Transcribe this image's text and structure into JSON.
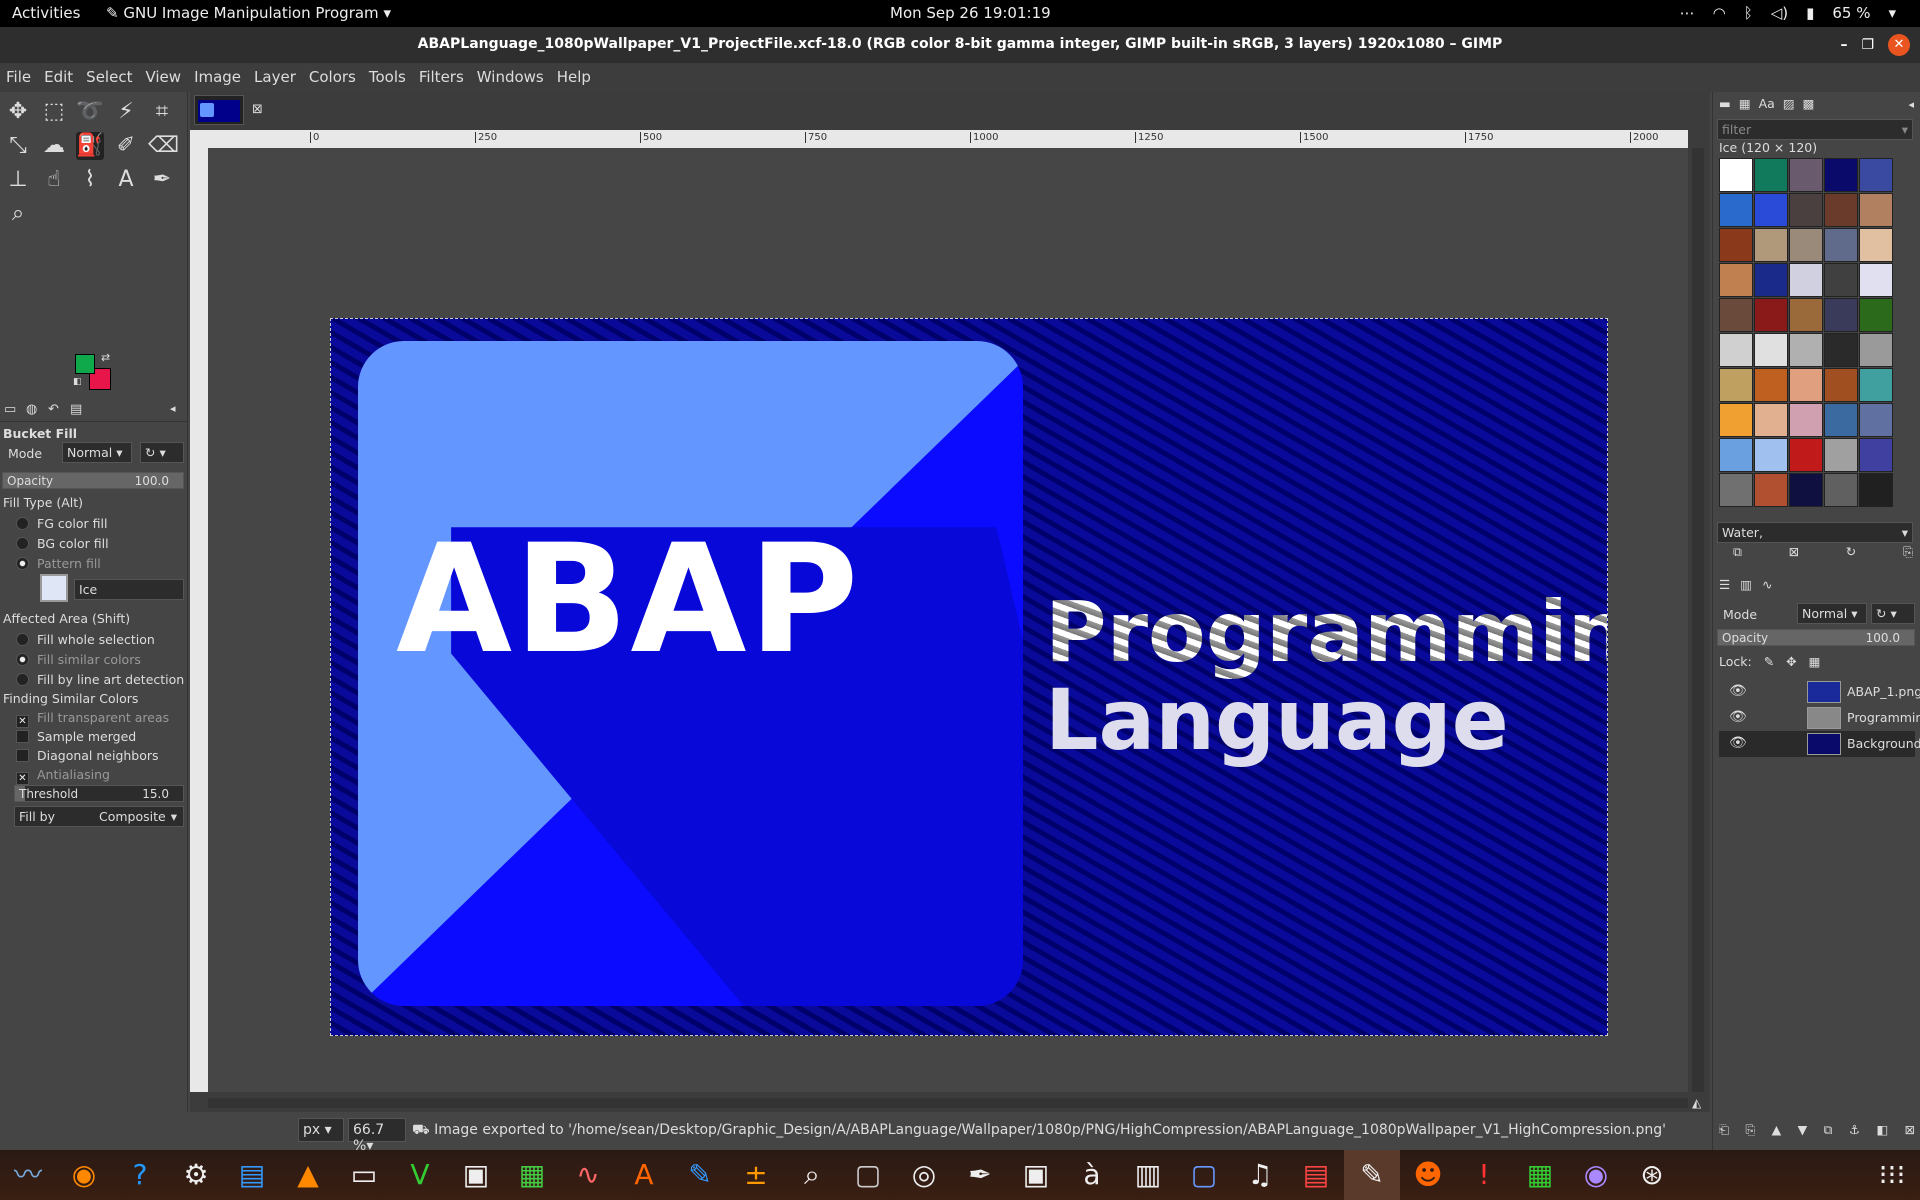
{
  "topbar": {
    "activities": "Activities",
    "app_name": "GNU Image Manipulation Program",
    "clock": "Mon Sep 26  19:01:19",
    "battery": "65 %"
  },
  "window": {
    "title": "ABAPLanguage_1080pWallpaper_V1_ProjectFile.xcf-18.0 (RGB color 8-bit gamma integer, GIMP built-in sRGB, 3 layers) 1920x1080 – GIMP"
  },
  "menu": [
    "File",
    "Edit",
    "Select",
    "View",
    "Image",
    "Layer",
    "Colors",
    "Tools",
    "Filters",
    "Windows",
    "Help"
  ],
  "colors": {
    "fg": "#0fa94b",
    "bg": "#e8154a"
  },
  "tool_options": {
    "title": "Bucket Fill",
    "mode_label": "Mode",
    "mode_value": "Normal",
    "opacity_label": "Opacity",
    "opacity_value": "100.0",
    "opacity_fraction": 1.0,
    "fill_type_label": "Fill Type  (Alt)",
    "fill_types": [
      "FG color fill",
      "BG color fill",
      "Pattern fill"
    ],
    "fill_type_selected": 2,
    "pattern_name": "Ice",
    "affected_area_label": "Affected Area  (Shift)",
    "affected_areas": [
      "Fill whole selection",
      "Fill similar colors",
      "Fill by line art detection"
    ],
    "affected_selected": 1,
    "finding_label": "Finding Similar Colors",
    "checks": [
      {
        "label": "Fill transparent areas",
        "checked": true
      },
      {
        "label": "Sample merged",
        "checked": false
      },
      {
        "label": "Diagonal neighbors",
        "checked": false
      },
      {
        "label": "Antialiasing",
        "checked": true
      }
    ],
    "threshold_label": "Threshold",
    "threshold_value": "15.0",
    "threshold_fraction": 0.06,
    "fill_by_label": "Fill by",
    "fill_by_value": "Composite"
  },
  "ruler": {
    "h_ticks": [
      "0",
      "250",
      "500",
      "750",
      "1000",
      "1250",
      "1500",
      "1750",
      "2000"
    ]
  },
  "canvas": {
    "logo_text": "ABAP",
    "line1": "Programming",
    "line2": "Language"
  },
  "status": {
    "unit": "px",
    "zoom": "66.7 %",
    "message": "Image exported to '/home/sean/Desktop/Graphic_Design/A/ABAPLanguage/Wallpaper/1080p/PNG/HighCompression/ABAPLanguage_1080pWallpaper_V1_HighCompression.png'"
  },
  "patterns": {
    "filter_placeholder": "filter",
    "current": "Ice (120 × 120)",
    "tag": "Water,",
    "swatches": [
      "#ffffff",
      "#127a5c",
      "#6a5a6e",
      "#0a0a6a",
      "#3a4aa0",
      "#2a6acc",
      "#2a4ad8",
      "#4a4040",
      "#6a3a2a",
      "#b08060",
      "#8a3a1a",
      "#b0987a",
      "#9a8a7a",
      "#606a8a",
      "#e0c0a0",
      "#c08050",
      "#1a2a8a",
      "#d0d0e0",
      "#404040",
      "#e0e0f0",
      "#6a4a3a",
      "#8a1a1a",
      "#9a6a3a",
      "#3a3a5a",
      "#2a6a1a",
      "#d0d0d0",
      "#e0e0e0",
      "#b0b0b0",
      "#2a2a2a",
      "#9a9a9a",
      "#c0a060",
      "#c06020",
      "#e0a080",
      "#a05020",
      "#40a0a0",
      "#f0a030",
      "#e0b090",
      "#d0a0b0",
      "#3a6aa0",
      "#6070a0",
      "#6aa0e0",
      "#a0c0f0",
      "#c01a1a",
      "#a0a0a0",
      "#4040a0",
      "#707070",
      "#b05030",
      "#101040",
      "#606060",
      "#202020"
    ]
  },
  "layers": {
    "mode_label": "Mode",
    "mode_value": "Normal",
    "opacity_label": "Opacity",
    "opacity_value": "100.0",
    "lock_label": "Lock:",
    "items": [
      {
        "name": "ABAP_1.png"
      },
      {
        "name": "Programming"
      },
      {
        "name": "Background"
      }
    ]
  }
}
